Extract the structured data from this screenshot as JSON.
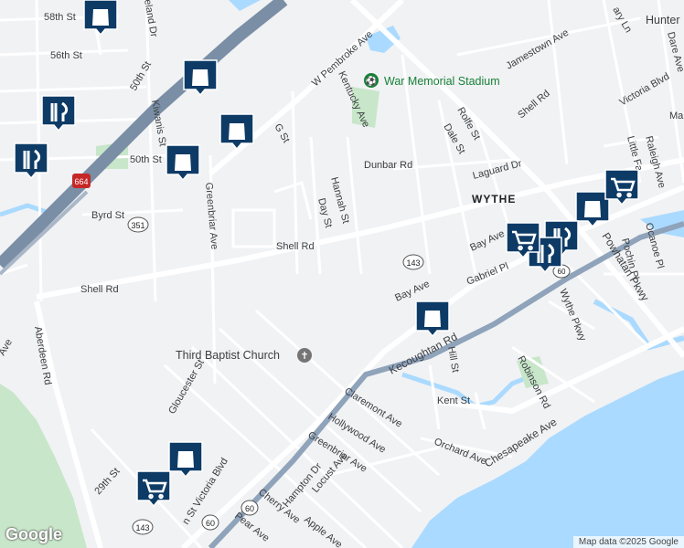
{
  "map": {
    "water_color": "#aadaff",
    "park_color": "#c8e6c9",
    "marker_color": "#0d3b66",
    "highway_color": "#7a8fa6",
    "shield_labels": {
      "i664": "664",
      "r351": "351",
      "r143a": "143",
      "r143b": "143",
      "r60a": "60",
      "r60b": "60",
      "r60c": "60"
    },
    "neighborhood": "WYTHE",
    "poi": {
      "stadium": "War Memorial Stadium",
      "church": "Third Baptist Church",
      "edge": "Hunter B."
    },
    "streets": {
      "s58": "58th St",
      "s56": "56th St",
      "s50a": "50th St",
      "s50b": "50th St",
      "kiwanis": "Kiwanis St",
      "eland": "eland Dr",
      "pembroke": "W Pembroke Ave",
      "kentucky": "Kentucky Ave",
      "gst": "G St",
      "hannah": "Hannah St",
      "day": "Day St",
      "dunbar": "Dunbar Rd",
      "byrd": "Byrd St",
      "greenbriar1": "Greenbriar Ave",
      "shell1": "Shell Rd",
      "shell2": "Shell Rd",
      "shell3": "Shell Rd",
      "aberdeen": "Aberdeen Rd",
      "ave_edge": "Ave",
      "rolfe": "Rolfe St",
      "dale": "Dale St",
      "jamestown": "Jamestown Ave",
      "victoria": "Victoria Blvd",
      "victoria2": "n St Victoria Blvd",
      "laguard": "Laguard Dr",
      "littlef": "Little Fa",
      "raleigh": "Raleigh Ave",
      "dare": "Dare Ave",
      "ma": "Ma",
      "bay1": "Bay Ave",
      "bay2": "Bay Ave",
      "gabriel": "Gabriel Pl",
      "pochin": "Pochin Pl",
      "ocanoe": "Ocanoe Pl",
      "powhatan": "Powhatan Pkwy",
      "wythepkwy": "Wythe Pkwy",
      "kecoughtan": "Kecoughtan Rd",
      "hill": "Hill St",
      "kent": "Kent St",
      "robinson": "Robinson Rd",
      "gloucester": "Gloucester St",
      "claremont": "Claremont Ave",
      "hollywood": "Hollywood Ave",
      "greenbriar2": "Greenbriar Ave",
      "orchard": "Orchard Ave",
      "chesapeake": "Chesapeake Ave",
      "s29": "29th St",
      "hampton": "Hampton Dr",
      "locust": "Locust Ave",
      "cherry": "Cherry Ave",
      "apple": "Apple Ave",
      "pear": "Pear Ave",
      "maryln": "ary Ln"
    }
  },
  "footer": {
    "copyright": "Map data ©2025 Google",
    "logo": "Google"
  }
}
